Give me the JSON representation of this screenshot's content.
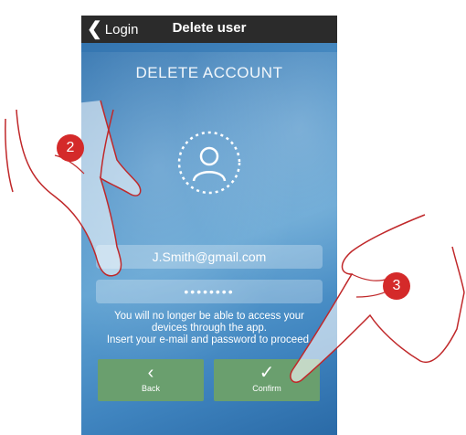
{
  "header": {
    "back_label": "Login",
    "title": "Delete user"
  },
  "heading": "DELETE ACCOUNT",
  "form": {
    "email": "J.Smith@gmail.com",
    "password_mask": "••••••••"
  },
  "info_lines": [
    "You will no longer be able to access your",
    "devices through the app.",
    "Insert your e-mail and password to proceed."
  ],
  "buttons": {
    "back": "Back",
    "confirm": "Confirm"
  },
  "steps": {
    "step2": "2",
    "step3": "3"
  },
  "icons": {
    "back_chevron": "chevron-left-icon",
    "avatar": "user-avatar-icon",
    "back_btn": "chevron-left-icon",
    "confirm_btn": "checkmark-icon"
  },
  "colors": {
    "header_bg": "#2b2b2b",
    "button_bg": "#6a9f6e",
    "step_badge": "#d42a2a",
    "hand_outline": "#c0282a"
  }
}
